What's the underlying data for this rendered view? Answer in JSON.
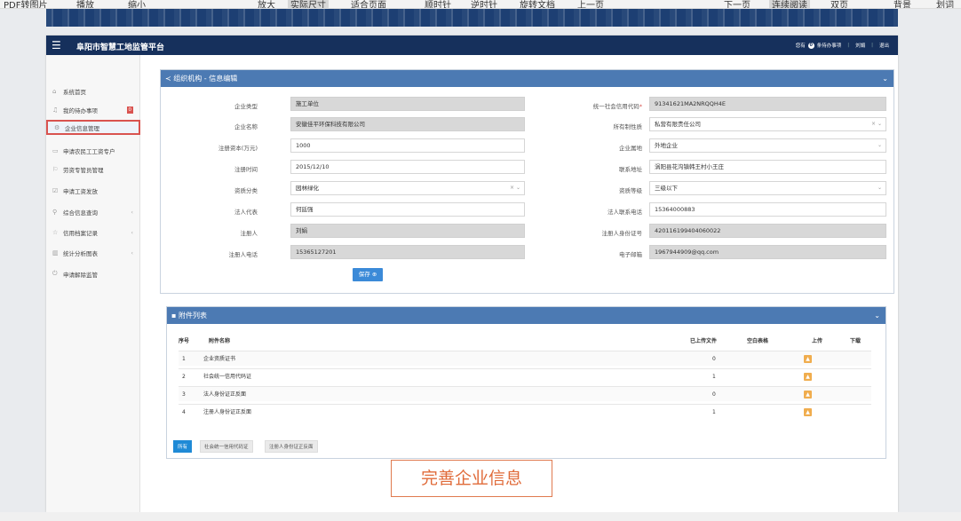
{
  "viewer": {
    "items": [
      "PDF转图片",
      "播放",
      "缩小",
      "放大",
      "实际尺寸",
      "适合页面",
      "顺时针",
      "逆时针",
      "旋转文档",
      "上一页",
      "下一页",
      "连续阅读",
      "双页",
      "背景",
      "划词"
    ]
  },
  "app": {
    "title": "阜阳市智慧工地监管平台",
    "header": {
      "prefix": "您有",
      "count": "0",
      "suffix": "条待办事项",
      "user": "刘娟",
      "logout": "退出"
    }
  },
  "sidebar": {
    "items": [
      {
        "label": "系统首页",
        "icon": "home-icon"
      },
      {
        "label": "我的待办事项",
        "icon": "bell-icon",
        "count": "0"
      },
      {
        "label": "企业信息管理",
        "icon": "gear-icon"
      },
      {
        "label": "申请农民工工资专户",
        "icon": "card-icon"
      },
      {
        "label": "劳资专管员管理",
        "icon": "flag-icon"
      },
      {
        "label": "申请工资发放",
        "icon": "check-icon"
      },
      {
        "label": "综合信息查询",
        "icon": "search-icon"
      },
      {
        "label": "信用档案记录",
        "icon": "star-icon"
      },
      {
        "label": "统计分析图表",
        "icon": "chart-icon"
      },
      {
        "label": "申请解除监管",
        "icon": "power-icon"
      }
    ]
  },
  "form": {
    "title": "组织机构 - 信息编辑",
    "fields": {
      "company_type": {
        "label": "企业类型",
        "value": "施工单位"
      },
      "credit_code": {
        "label": "统一社会信用代码",
        "value": "91341621MA2NRQQH4E"
      },
      "company_name": {
        "label": "企业名称",
        "value": "安徽佳平环保科技有限公司"
      },
      "ownership": {
        "label": "所有制性质",
        "value": "私营有限责任公司"
      },
      "capital": {
        "label": "注册资本(万元)",
        "value": "1000"
      },
      "belong": {
        "label": "企业属地",
        "value": "外地企业"
      },
      "reg_date": {
        "label": "注册时间",
        "value": "2015/12/10"
      },
      "address": {
        "label": "联系地址",
        "value": "涡阳县花沟镇韩王村小王庄"
      },
      "qualification": {
        "label": "资质分类",
        "value": "园林绿化"
      },
      "grade": {
        "label": "资质等级",
        "value": "三级以下"
      },
      "legal": {
        "label": "法人代表",
        "value": "何廷强"
      },
      "legal_phone": {
        "label": "法人联系电话",
        "value": "15364000883"
      },
      "registrant": {
        "label": "注册人",
        "value": "刘娟"
      },
      "registrant_id": {
        "label": "注册人身份证号",
        "value": "420116199404060022"
      },
      "registrant_phone": {
        "label": "注册人电话",
        "value": "15365127201"
      },
      "email": {
        "label": "电子邮箱",
        "value": "1967944909@qq.com"
      }
    },
    "save_label": "保存"
  },
  "attachments": {
    "title": "附件列表",
    "columns": [
      "序号",
      "附件名称",
      "已上传文件",
      "空白表格",
      "上传",
      "下载"
    ],
    "rows": [
      {
        "no": "1",
        "name": "企业资质证书",
        "uploaded": "0"
      },
      {
        "no": "2",
        "name": "社会统一信用代码证",
        "uploaded": "1"
      },
      {
        "no": "3",
        "name": "法人身份证正反面",
        "uploaded": "0"
      },
      {
        "no": "4",
        "name": "注册人身份证正反面",
        "uploaded": "1"
      }
    ],
    "tabs": [
      "所有",
      "社会统一信用代码证",
      "注册人身份证正反面"
    ]
  },
  "callout": "完善企业信息"
}
